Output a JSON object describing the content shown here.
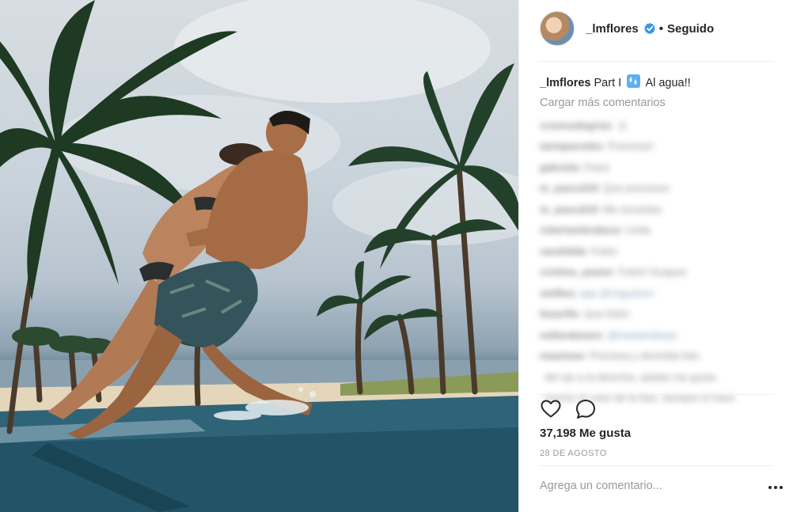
{
  "post": {
    "username": "_lmflores",
    "follow_separator": "•",
    "follow_status": "Seguido",
    "caption_user": "_lmflores",
    "caption_text_before": "Part I",
    "caption_emoji_icon": "droplets-icon",
    "caption_text_after": "Al agua!!",
    "load_more": "Cargar más comentarios",
    "likes": "37,198 Me gusta",
    "date": "28 DE AGOSTO",
    "comment_placeholder": "Agrega un comentario...",
    "comments": [
      {
        "user": "cosmoalegrias",
        "text": ":))"
      },
      {
        "user": "taniaparedes",
        "text": "Preciosa!!"
      },
      {
        "user": "gabriela",
        "text": "Fotos"
      },
      {
        "user": "m_pascal19",
        "text": "Que preciosos"
      },
      {
        "user": "m_pascal19",
        "text": "Me encantas"
      },
      {
        "user": "robertanbrabeza",
        "text": "Linda"
      },
      {
        "user": "sarahbbb",
        "text": "Fotón"
      },
      {
        "user": "cristina_pastor",
        "text": "Fotón! Guapos"
      },
      {
        "user": "stefbes",
        "text": "jaja @migueluvi"
      },
      {
        "user": "fasarillo",
        "text": "Que fotón"
      },
      {
        "user": "nellarabeans",
        "text": "@martanskaya"
      },
      {
        "user": "maarteee",
        "text": "Preciosa y divertida foto"
      },
      {
        "user": "",
        "text": "del ojo a la derecha, aiadas me gusta"
      },
      {
        "user": "",
        "text": "mucho el color de la foto, siempre lo hace"
      }
    ]
  },
  "colors": {
    "verified_blue": "#3897f0",
    "text": "#262626",
    "muted": "#999999",
    "divider": "#efefef"
  }
}
